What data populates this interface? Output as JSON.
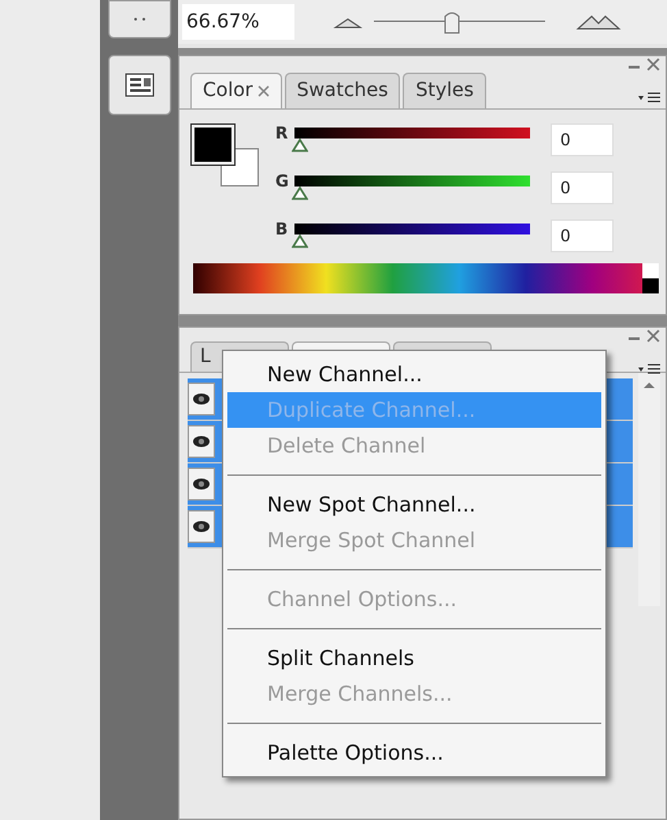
{
  "zoom": {
    "value": "66.67%",
    "level": 0.45
  },
  "color_panel": {
    "tabs": [
      {
        "label": "Color",
        "selected": true,
        "closable": true
      },
      {
        "label": "Swatches",
        "selected": false,
        "closable": false
      },
      {
        "label": "Styles",
        "selected": false,
        "closable": false
      }
    ],
    "channels": [
      {
        "label": "R",
        "level": 0,
        "value": "0"
      },
      {
        "label": "G",
        "level": 0,
        "value": "0"
      },
      {
        "label": "B",
        "level": 0,
        "value": "0"
      }
    ]
  },
  "channels_panel": {
    "tabs": [
      {
        "label": "L",
        "selected": false
      },
      {
        "selected": true
      },
      {
        "selected": false
      }
    ],
    "rows": [
      {
        "visible": true,
        "selected": true
      },
      {
        "visible": true,
        "selected": true
      },
      {
        "visible": true,
        "selected": true
      },
      {
        "visible": true,
        "selected": true
      }
    ]
  },
  "menu": {
    "items": [
      {
        "kind": "item",
        "label": "New Channel...",
        "disabled": false,
        "selected": false
      },
      {
        "kind": "item",
        "label": "Duplicate Channel...",
        "disabled": true,
        "selected": true
      },
      {
        "kind": "item",
        "label": "Delete Channel",
        "disabled": true,
        "selected": false
      },
      {
        "kind": "separator"
      },
      {
        "kind": "item",
        "label": "New Spot Channel...",
        "disabled": false,
        "selected": false
      },
      {
        "kind": "item",
        "label": "Merge Spot Channel",
        "disabled": true,
        "selected": false
      },
      {
        "kind": "separator"
      },
      {
        "kind": "item",
        "label": "Channel Options...",
        "disabled": true,
        "selected": false
      },
      {
        "kind": "separator"
      },
      {
        "kind": "item",
        "label": "Split Channels",
        "disabled": false,
        "selected": false
      },
      {
        "kind": "item",
        "label": "Merge Channels...",
        "disabled": true,
        "selected": false
      },
      {
        "kind": "separator"
      },
      {
        "kind": "item",
        "label": "Palette Options...",
        "disabled": false,
        "selected": false
      }
    ]
  }
}
